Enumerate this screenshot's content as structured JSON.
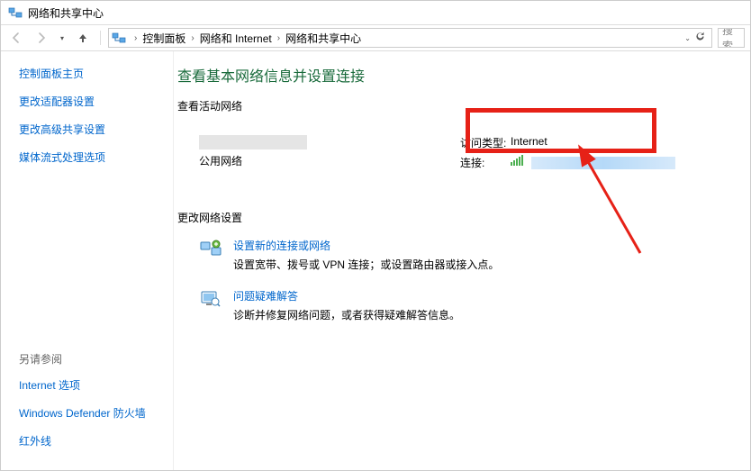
{
  "window": {
    "title": "网络和共享中心"
  },
  "breadcrumbs": {
    "items": [
      "控制面板",
      "网络和 Internet",
      "网络和共享中心"
    ]
  },
  "search": {
    "placeholder": "搜索"
  },
  "sidebar": {
    "links": [
      {
        "label": "控制面板主页"
      },
      {
        "label": "更改适配器设置"
      },
      {
        "label": "更改高级共享设置"
      },
      {
        "label": "媒体流式处理选项"
      }
    ],
    "see_also_heading": "另请参阅",
    "see_also": [
      {
        "label": "Internet 选项"
      },
      {
        "label": "Windows Defender 防火墙"
      },
      {
        "label": "红外线"
      }
    ]
  },
  "main": {
    "title": "查看基本网络信息并设置连接",
    "active_network_label": "查看活动网络",
    "network_type": "公用网络",
    "access_type_label": "访问类型:",
    "access_type_value": "Internet",
    "connections_label": "连接:",
    "change_settings_label": "更改网络设置",
    "items": [
      {
        "link": "设置新的连接或网络",
        "desc": "设置宽带、拨号或 VPN 连接；或设置路由器或接入点。"
      },
      {
        "link": "问题疑难解答",
        "desc": "诊断并修复网络问题，或者获得疑难解答信息。"
      }
    ]
  }
}
